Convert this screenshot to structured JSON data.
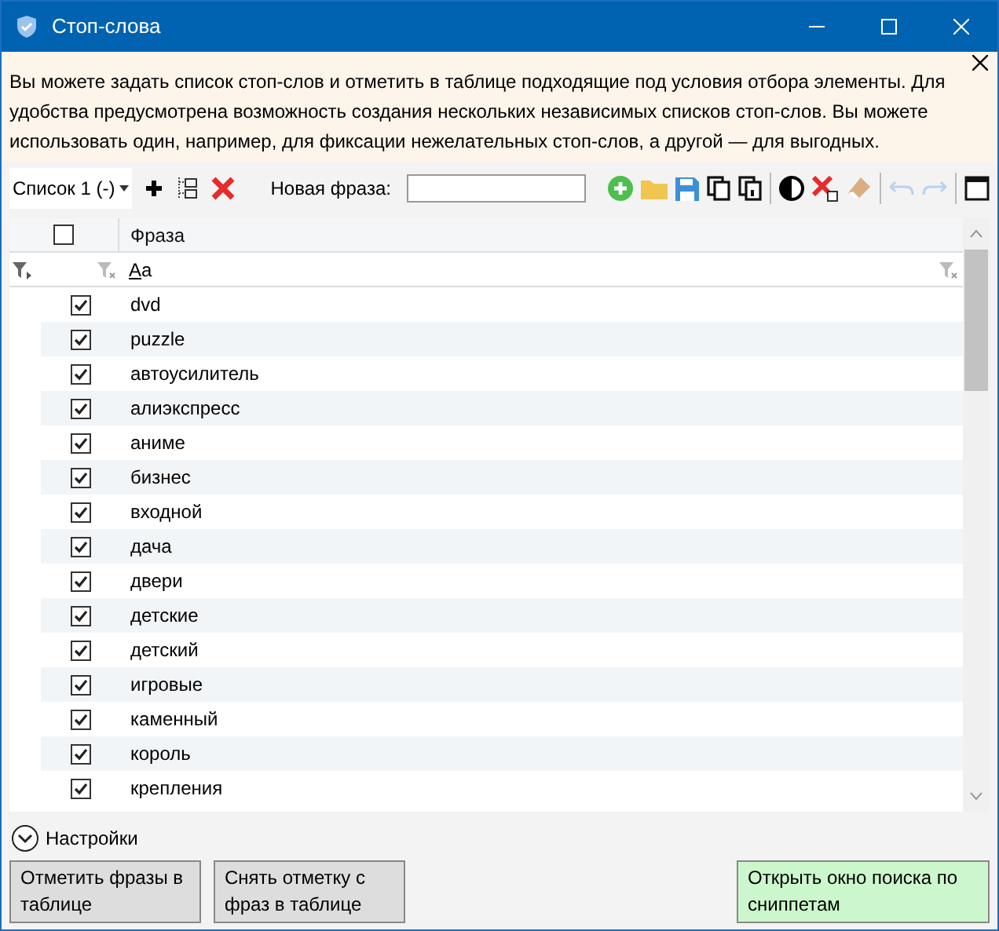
{
  "window": {
    "title": "Стоп-слова"
  },
  "info": {
    "text": "Вы можете задать список стоп-слов и отметить в таблице подходящие под условия отбора элементы. Для удобства предусмотрена возможность создания нескольких независимых списков стоп-слов. Вы можете использовать один, например, для фиксации нежелательных стоп-слов, а другой — для выгодных."
  },
  "toolbar": {
    "list": "Список 1 (-)",
    "phrase_label": "Новая фраза:"
  },
  "table": {
    "header_checked": false,
    "column": "Фраза",
    "filter": "Aa",
    "rows": [
      {
        "text": "dvd",
        "checked": true
      },
      {
        "text": "puzzle",
        "checked": true
      },
      {
        "text": "автоусилитель",
        "checked": true
      },
      {
        "text": "алиэкспресс",
        "checked": true
      },
      {
        "text": "аниме",
        "checked": true
      },
      {
        "text": "бизнес",
        "checked": true
      },
      {
        "text": "входной",
        "checked": true
      },
      {
        "text": "дача",
        "checked": true
      },
      {
        "text": "двери",
        "checked": true
      },
      {
        "text": "детские",
        "checked": true
      },
      {
        "text": "детский",
        "checked": true
      },
      {
        "text": "игровые",
        "checked": true
      },
      {
        "text": "каменный",
        "checked": true
      },
      {
        "text": "король",
        "checked": true
      },
      {
        "text": "крепления",
        "checked": true
      }
    ]
  },
  "settings": {
    "label": "Настройки",
    "expanded": false
  },
  "buttons": [
    {
      "label": "Отметить фразы в таблице",
      "kind": "plain"
    },
    {
      "label": "Снять отметку с фраз в таблице",
      "kind": "plain"
    },
    {
      "label": "Открыть окно поиска по сниппетам",
      "kind": "accent"
    }
  ]
}
